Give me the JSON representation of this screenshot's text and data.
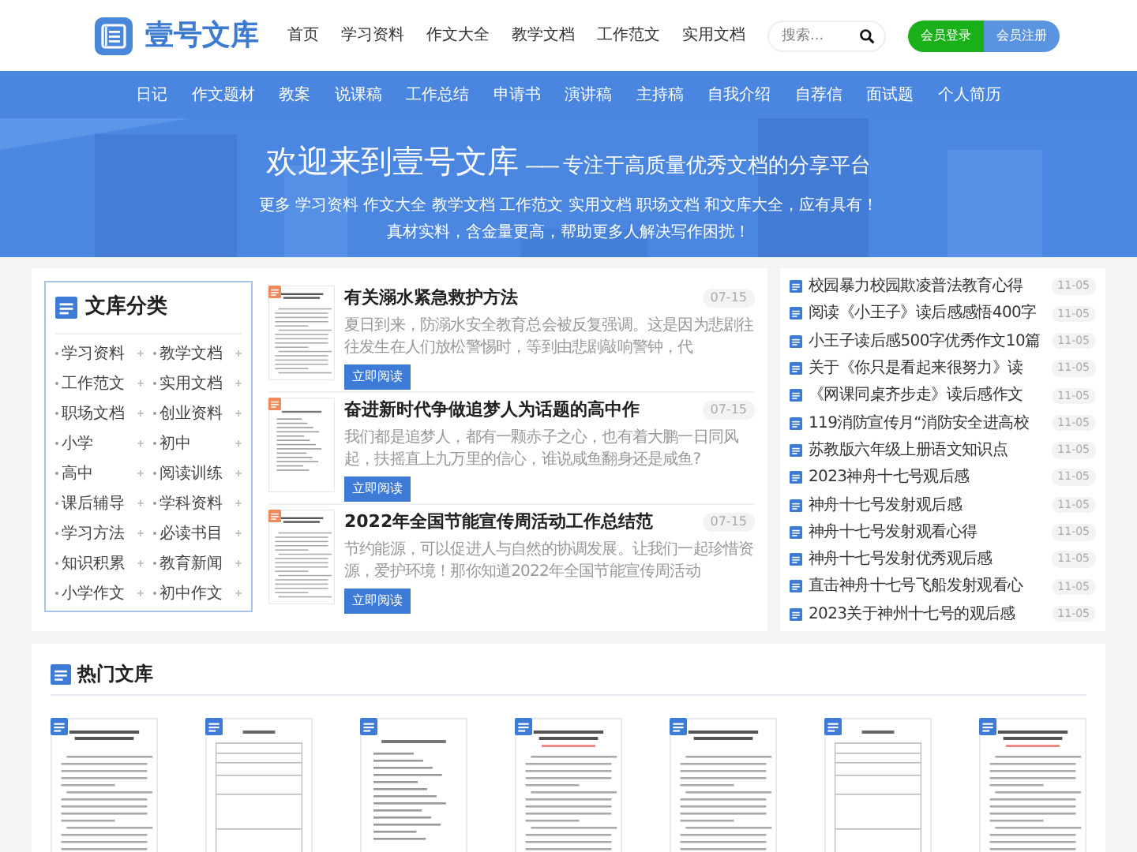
{
  "header": {
    "logo_text": "壹号文库",
    "nav": [
      "首页",
      "学习资料",
      "作文大全",
      "教学文档",
      "工作范文",
      "实用文档"
    ],
    "search": {
      "placeholder": "搜索..."
    },
    "buttons": [
      {
        "label": "会员登录",
        "kind": "login"
      },
      {
        "label": "会员注册",
        "kind": "register"
      }
    ]
  },
  "category_nav": [
    "日记",
    "作文题材",
    "教案",
    "说课稿",
    "工作总结",
    "申请书",
    "演讲稿",
    "主持稿",
    "自我介绍",
    "自荐信",
    "面试题",
    "个人简历"
  ],
  "banner": {
    "title": "欢迎来到壹号文库",
    "dash": "——",
    "subtitle": "专注于高质量优秀文档的分享平台",
    "lines": [
      "更多 学习资料 作文大全 教学文档 工作范文 实用文档 职场文档 和文库大全，应有具有！",
      "真材实料，含金量更高，帮助更多人解决写作困扰！"
    ]
  },
  "categories": {
    "title": "文库分类",
    "items": [
      "学习资料",
      "教学文档",
      "工作范文",
      "实用文档",
      "职场文档",
      "创业资料",
      "小学",
      "初中",
      "高中",
      "阅读训练",
      "课后辅导",
      "学科资料",
      "学习方法",
      "必读书目",
      "知识积累",
      "教育新闻",
      "小学作文",
      "初中作文"
    ]
  },
  "articles": [
    {
      "title": "有关溺水紧急救护方法",
      "date": "07-15",
      "excerpt": "夏日到来，防溺水安全教育总会被反复强调。这是因为悲剧往往发生在人们放松警惕时，等到由悲剧敲响警钟，代",
      "button": "立即阅读"
    },
    {
      "title": "奋进新时代争做追梦人为话题的高中作",
      "date": "07-15",
      "excerpt": "我们都是追梦人，都有一颗赤子之心，也有着大鹏一日同风起，扶摇直上九万里的信心，谁说咸鱼翻身还是咸鱼?",
      "button": "立即阅读"
    },
    {
      "title": "2022年全国节能宣传周活动工作总结范",
      "date": "07-15",
      "excerpt": "节约能源，可以促进人与自然的协调发展。让我们一起珍惜资源，爱护环境！那你知道2022年全国节能宣传周活动",
      "button": "立即阅读"
    }
  ],
  "latest": [
    {
      "title": "校园暴力校园欺凌普法教育心得",
      "date": "11-05"
    },
    {
      "title": "阅读《小王子》读后感感悟400字",
      "date": "11-05"
    },
    {
      "title": "小王子读后感500字优秀作文10篇",
      "date": "11-05"
    },
    {
      "title": "关于《你只是看起来很努力》读",
      "date": "11-05"
    },
    {
      "title": "《网课同桌齐步走》读后感作文",
      "date": "11-05"
    },
    {
      "title": "119消防宣传月“消防安全进高校",
      "date": "11-05"
    },
    {
      "title": "苏教版六年级上册语文知识点",
      "date": "11-05"
    },
    {
      "title": "2023神舟十七号观后感",
      "date": "11-05"
    },
    {
      "title": "神舟十七号发射观后感",
      "date": "11-05"
    },
    {
      "title": "神舟十七号发射观看心得",
      "date": "11-05"
    },
    {
      "title": "神舟十七号发射优秀观后感",
      "date": "11-05"
    },
    {
      "title": "直击神舟十七号飞船发射观看心",
      "date": "11-05"
    },
    {
      "title": "2023关于神州十七号的观后感",
      "date": "11-05"
    }
  ],
  "hot": {
    "title": "热门文库",
    "documents": [
      {
        "kind": "essay"
      },
      {
        "kind": "form"
      },
      {
        "kind": "outline"
      },
      {
        "kind": "essay"
      },
      {
        "kind": "essay"
      },
      {
        "kind": "form"
      },
      {
        "kind": "essay"
      }
    ]
  }
}
